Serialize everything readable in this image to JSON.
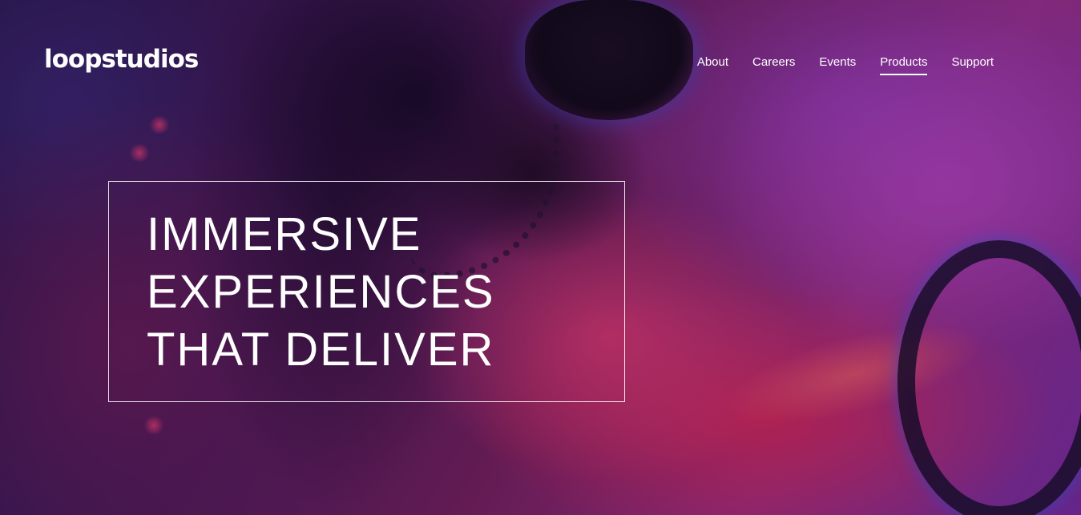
{
  "header": {
    "logo": "loopstudios",
    "nav": [
      {
        "label": "About",
        "active": false
      },
      {
        "label": "Careers",
        "active": false
      },
      {
        "label": "Events",
        "active": false
      },
      {
        "label": "Products",
        "active": true
      },
      {
        "label": "Support",
        "active": false
      }
    ]
  },
  "hero": {
    "headline_lines": [
      "IMMERSIVE",
      "EXPERIENCES",
      "THAT DELIVER"
    ]
  },
  "colors": {
    "text": "#ffffff",
    "background_accent": "#a3308a"
  }
}
